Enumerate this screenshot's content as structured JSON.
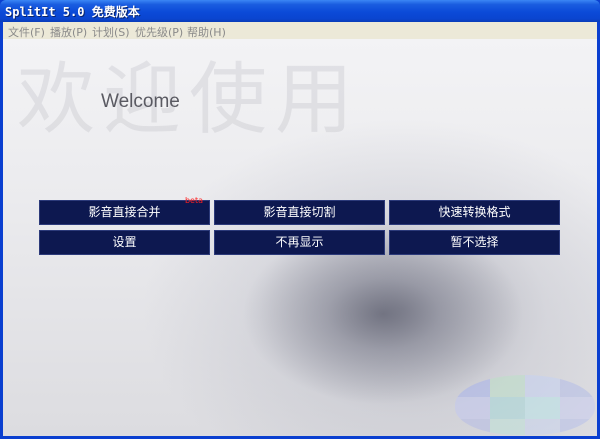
{
  "window": {
    "title": "SplitIt 5.0 免费版本"
  },
  "menu": [
    {
      "label": "文件(F)"
    },
    {
      "label": "播放(P)"
    },
    {
      "label": "计划(S)"
    },
    {
      "label": "优先级(P)"
    },
    {
      "label": "帮助(H)"
    }
  ],
  "main": {
    "watermark": "欢迎使用",
    "welcome": "Welcome",
    "buttons": [
      {
        "label": "影音直接合并",
        "badge": "beta"
      },
      {
        "label": "影音直接切割"
      },
      {
        "label": "快速转换格式"
      },
      {
        "label": "设置"
      },
      {
        "label": "不再显示"
      },
      {
        "label": "暂不选择"
      }
    ]
  },
  "colors": {
    "button_bg": "#0d1850",
    "titlebar": "#0a45d0",
    "beta": "#ff2020"
  }
}
